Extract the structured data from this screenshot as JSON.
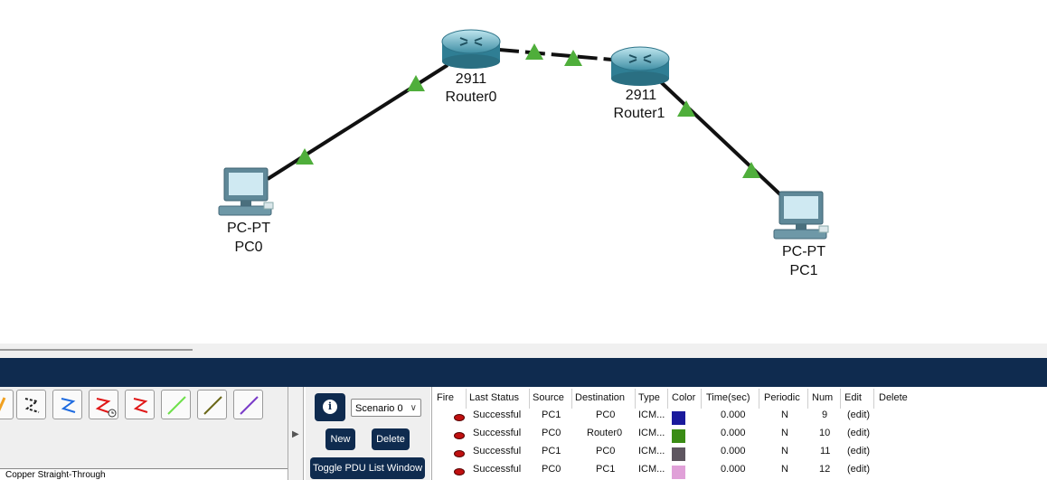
{
  "devices": [
    {
      "model": "2911",
      "name": "Router0"
    },
    {
      "model": "2911",
      "name": "Router1"
    },
    {
      "model": "PC-PT",
      "name": "PC0"
    },
    {
      "model": "PC-PT",
      "name": "PC1"
    }
  ],
  "links": [
    {
      "from": "PC0",
      "to": "Router0",
      "type": "copper-straight",
      "status": "up"
    },
    {
      "from": "Router0",
      "to": "Router1",
      "type": "serial",
      "status": "up"
    },
    {
      "from": "Router1",
      "to": "PC1",
      "type": "copper-straight",
      "status": "up"
    }
  ],
  "connections_panel": {
    "tool_icons": [
      "auto-connection-icon",
      "console-icon",
      "copper-straight-icon",
      "serial-dce-clock-icon",
      "serial-dte-icon",
      "fiber-icon",
      "phone-cable-icon",
      "coaxial-icon"
    ],
    "status_text": "Copper Straight-Through"
  },
  "scenario": {
    "info_label": "i",
    "selected": "Scenario 0",
    "new_label": "New",
    "delete_label": "Delete",
    "toggle_label": "Toggle PDU List Window"
  },
  "pdu_table": {
    "headers": [
      "Fire",
      "Last Status",
      "Source",
      "Destination",
      "Type",
      "Color",
      "Time(sec)",
      "Periodic",
      "Num",
      "Edit",
      "Delete"
    ],
    "rows": [
      {
        "status": "Successful",
        "source": "PC1",
        "destination": "PC0",
        "type": "ICM...",
        "color": "#1a1a9c",
        "time": "0.000",
        "periodic": "N",
        "num": "9",
        "edit": "(edit)"
      },
      {
        "status": "Successful",
        "source": "PC0",
        "destination": "Router0",
        "type": "ICM...",
        "color": "#3a8c15",
        "time": "0.000",
        "periodic": "N",
        "num": "10",
        "edit": "(edit)"
      },
      {
        "status": "Successful",
        "source": "PC1",
        "destination": "PC0",
        "type": "ICM...",
        "color": "#5e5660",
        "time": "0.000",
        "periodic": "N",
        "num": "11",
        "edit": "(edit)"
      },
      {
        "status": "Successful",
        "source": "PC0",
        "destination": "PC1",
        "type": "ICM...",
        "color": "#e0a0d8",
        "time": "0.000",
        "periodic": "N",
        "num": "12",
        "edit": "(edit)"
      }
    ]
  },
  "colors": {
    "navy": "#0f2b4f",
    "link_up": "#4fae3b"
  }
}
